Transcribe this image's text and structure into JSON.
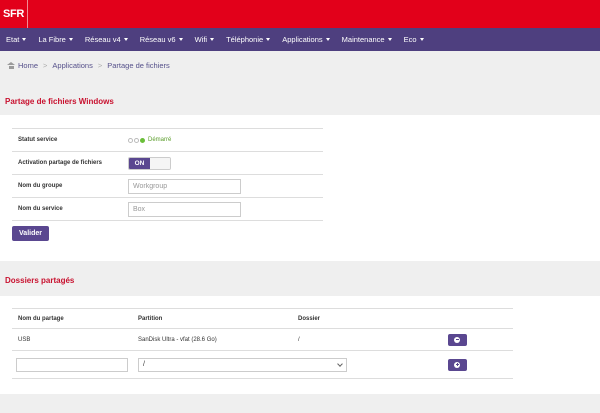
{
  "brand": {
    "logo": "SFR"
  },
  "nav": {
    "items": [
      "Etat",
      "La Fibre",
      "Réseau v4",
      "Réseau v6",
      "Wifi",
      "Téléphonie",
      "Applications",
      "Maintenance",
      "Eco"
    ]
  },
  "breadcrumb": {
    "home": "Home",
    "applications": "Applications",
    "current": "Partage de fichiers"
  },
  "windows_share": {
    "title": "Partage de fichiers Windows",
    "status_label": "Statut service",
    "status_value": "Démarré",
    "activation_label": "Activation partage de fichiers",
    "toggle_on": "ON",
    "group_label": "Nom du groupe",
    "group_placeholder": "Workgroup",
    "service_label": "Nom du service",
    "service_placeholder": "Box",
    "submit_label": "Valider"
  },
  "shared_folders": {
    "title": "Dossiers partagés",
    "columns": [
      "Nom du partage",
      "Partition",
      "Dossier"
    ],
    "rows": [
      {
        "name": "USB",
        "partition": "SanDisk Ultra - vfat (28.6 Go)",
        "folder": "/"
      }
    ],
    "new_row": {
      "partition_value": "/"
    }
  },
  "colors": {
    "brand_red": "#e2001a",
    "nav_purple": "#4e3f7f",
    "button_purple": "#5a4790",
    "title_red": "#c8102e"
  }
}
